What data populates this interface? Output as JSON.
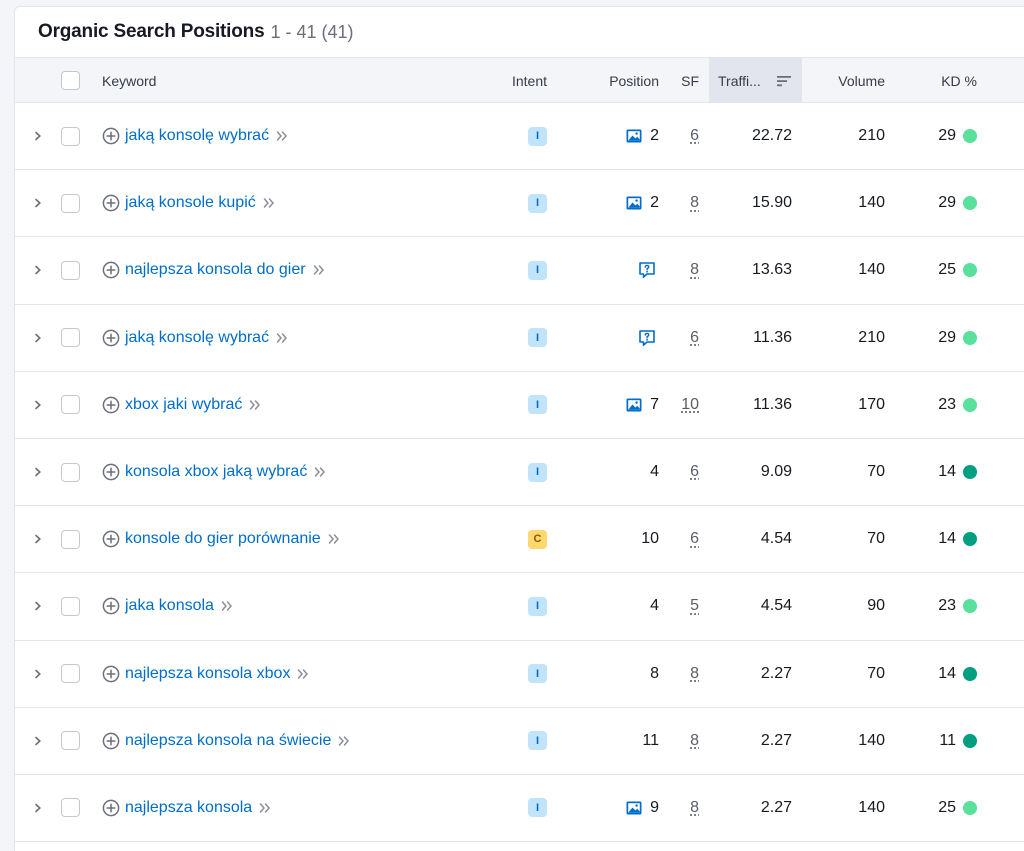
{
  "panel": {
    "title": "Organic Search Positions",
    "range": "1 - 41 (41)"
  },
  "columns": {
    "keyword": "Keyword",
    "intent": "Intent",
    "position": "Position",
    "sf": "SF",
    "traffic": "Traffi...",
    "volume": "Volume",
    "kd": "KD %"
  },
  "colors": {
    "link": "#006dca",
    "intent_informational_bg": "#c2e4fa",
    "intent_informational_fg": "#006dca",
    "intent_commercial_bg": "#fcd86f",
    "intent_commercial_fg": "#8a5a00",
    "kd_light": "#59e09b",
    "kd_dark": "#009f81",
    "serp_icon": "#006dca"
  },
  "rows": [
    {
      "keyword": "jaką konsolę wybrać",
      "intent": "I",
      "serp": "image-icon",
      "position": "2",
      "sf": "6",
      "traffic": "22.72",
      "volume": "210",
      "kd": "29",
      "kd_level": "light"
    },
    {
      "keyword": "jaką konsole kupić",
      "intent": "I",
      "serp": "image-icon",
      "position": "2",
      "sf": "8",
      "traffic": "15.90",
      "volume": "140",
      "kd": "29",
      "kd_level": "light"
    },
    {
      "keyword": "najlepsza konsola do gier",
      "intent": "I",
      "serp": "faq-icon",
      "position": "",
      "sf": "8",
      "traffic": "13.63",
      "volume": "140",
      "kd": "25",
      "kd_level": "light"
    },
    {
      "keyword": "jaką konsolę wybrać",
      "intent": "I",
      "serp": "faq-icon",
      "position": "",
      "sf": "6",
      "traffic": "11.36",
      "volume": "210",
      "kd": "29",
      "kd_level": "light"
    },
    {
      "keyword": "xbox jaki wybrać",
      "intent": "I",
      "serp": "image-icon",
      "position": "7",
      "sf": "10",
      "traffic": "11.36",
      "volume": "170",
      "kd": "23",
      "kd_level": "light"
    },
    {
      "keyword": "konsola xbox jaką wybrać",
      "intent": "I",
      "serp": "",
      "position": "4",
      "sf": "6",
      "traffic": "9.09",
      "volume": "70",
      "kd": "14",
      "kd_level": "dark"
    },
    {
      "keyword": "konsole do gier porównanie",
      "intent": "C",
      "serp": "",
      "position": "10",
      "sf": "6",
      "traffic": "4.54",
      "volume": "70",
      "kd": "14",
      "kd_level": "dark"
    },
    {
      "keyword": "jaka konsola",
      "intent": "I",
      "serp": "",
      "position": "4",
      "sf": "5",
      "traffic": "4.54",
      "volume": "90",
      "kd": "23",
      "kd_level": "light"
    },
    {
      "keyword": "najlepsza konsola xbox",
      "intent": "I",
      "serp": "",
      "position": "8",
      "sf": "8",
      "traffic": "2.27",
      "volume": "70",
      "kd": "14",
      "kd_level": "dark"
    },
    {
      "keyword": "najlepsza konsola na świecie",
      "intent": "I",
      "serp": "",
      "position": "11",
      "sf": "8",
      "traffic": "2.27",
      "volume": "140",
      "kd": "11",
      "kd_level": "dark"
    },
    {
      "keyword": "najlepsza konsola",
      "intent": "I",
      "serp": "image-icon",
      "position": "9",
      "sf": "8",
      "traffic": "2.27",
      "volume": "140",
      "kd": "25",
      "kd_level": "light"
    }
  ]
}
